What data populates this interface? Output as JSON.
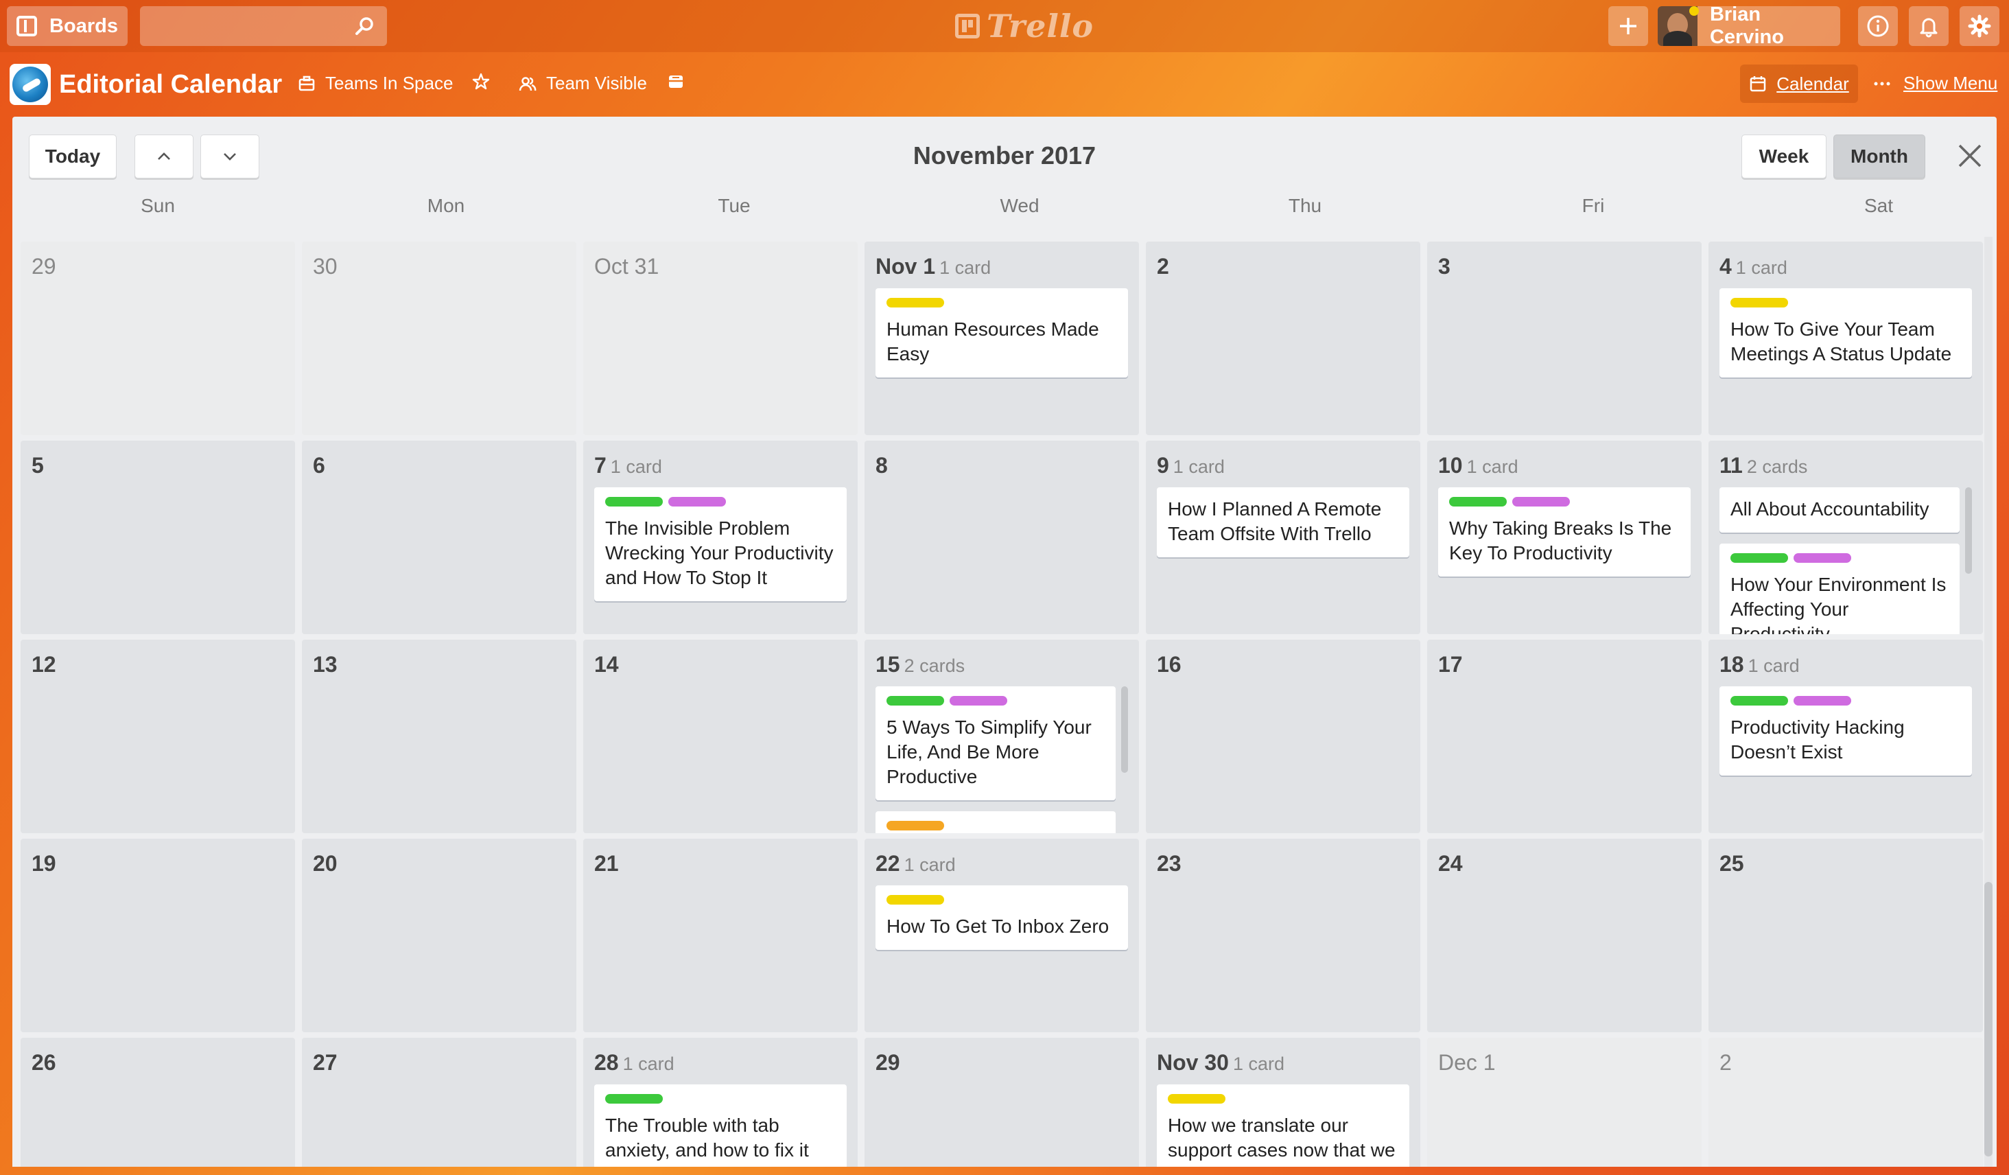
{
  "topbar": {
    "boards_label": "Boards",
    "search_placeholder": "",
    "logo_text": "Trello",
    "user_name": "Brian Cervino"
  },
  "board": {
    "title": "Editorial Calendar",
    "team": "Teams In Space",
    "visibility": "Team Visible",
    "calendar_label": "Calendar",
    "show_menu_label": "Show Menu"
  },
  "calendar": {
    "today_label": "Today",
    "month_title": "November 2017",
    "week_label": "Week",
    "month_label": "Month",
    "weekdays": [
      "Sun",
      "Mon",
      "Tue",
      "Wed",
      "Thu",
      "Fri",
      "Sat"
    ],
    "weeks": [
      [
        {
          "label": "29",
          "other": true
        },
        {
          "label": "30",
          "other": true
        },
        {
          "label": "Oct 31",
          "other": true
        },
        {
          "label": "Nov 1",
          "count": "1 card",
          "cards": [
            {
              "labels": [
                "#f2d600"
              ],
              "title": "Human Resources Made Easy"
            }
          ]
        },
        {
          "label": "2"
        },
        {
          "label": "3"
        },
        {
          "label": "4",
          "count": "1 card",
          "cards": [
            {
              "labels": [
                "#f2d600"
              ],
              "title": "How To Give Your Team Meetings A Status Update"
            }
          ]
        }
      ],
      [
        {
          "label": "5"
        },
        {
          "label": "6"
        },
        {
          "label": "7",
          "count": "1 card",
          "cards": [
            {
              "labels": [
                "#3cc93c",
                "#cf6be0"
              ],
              "title": "The Invisible Problem Wrecking Your Productivity and How To Stop It"
            }
          ]
        },
        {
          "label": "8"
        },
        {
          "label": "9",
          "count": "1 card",
          "cards": [
            {
              "labels": [],
              "title": "How I Planned A Remote Team Offsite With Trello"
            }
          ]
        },
        {
          "label": "10",
          "count": "1 card",
          "cards": [
            {
              "labels": [
                "#3cc93c",
                "#cf6be0"
              ],
              "title": "Why Taking Breaks Is The Key To Productivity"
            }
          ]
        },
        {
          "label": "11",
          "count": "2 cards",
          "scroll": true,
          "cards": [
            {
              "labels": [],
              "title": "All About Accountability"
            },
            {
              "labels": [
                "#3cc93c",
                "#cf6be0"
              ],
              "title": "How Your Environment Is Affecting Your Productivity"
            }
          ]
        }
      ],
      [
        {
          "label": "12"
        },
        {
          "label": "13"
        },
        {
          "label": "14"
        },
        {
          "label": "15",
          "count": "2 cards",
          "scroll": true,
          "cards": [
            {
              "labels": [
                "#3cc93c",
                "#cf6be0"
              ],
              "title": "5 Ways To Simplify Your Life, And Be More Productive"
            },
            {
              "labels": [
                "#f5a623"
              ],
              "title": ""
            }
          ]
        },
        {
          "label": "16"
        },
        {
          "label": "17"
        },
        {
          "label": "18",
          "count": "1 card",
          "cards": [
            {
              "labels": [
                "#3cc93c",
                "#cf6be0"
              ],
              "title": "Productivity Hacking Doesn’t Exist"
            }
          ]
        }
      ],
      [
        {
          "label": "19"
        },
        {
          "label": "20"
        },
        {
          "label": "21"
        },
        {
          "label": "22",
          "count": "1 card",
          "cards": [
            {
              "labels": [
                "#f2d600"
              ],
              "title": "How To Get To Inbox Zero"
            }
          ]
        },
        {
          "label": "23"
        },
        {
          "label": "24"
        },
        {
          "label": "25"
        }
      ],
      [
        {
          "label": "26"
        },
        {
          "label": "27"
        },
        {
          "label": "28",
          "count": "1 card",
          "cards": [
            {
              "labels": [
                "#3cc93c"
              ],
              "title": "The Trouble with tab anxiety, and how to fix it"
            }
          ]
        },
        {
          "label": "29"
        },
        {
          "label": "Nov 30",
          "count": "1 card",
          "cards": [
            {
              "labels": [
                "#f2d600"
              ],
              "title": "How we translate our support cases now that we"
            }
          ]
        },
        {
          "label": "Dec 1",
          "other": true
        },
        {
          "label": "2",
          "other": true
        }
      ]
    ]
  }
}
